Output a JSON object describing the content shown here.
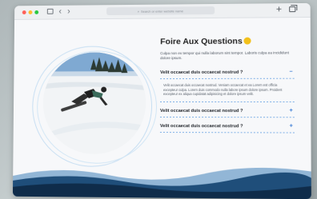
{
  "browser": {
    "colors": {
      "red": "#ff5f57",
      "yellow": "#febc2e",
      "green": "#28c840"
    },
    "address_text": "Search or enter website name",
    "icons": [
      "sidebar-icon",
      "back-icon",
      "forward-icon",
      "search-icon",
      "new-tab-icon",
      "tabs-overview-icon"
    ]
  },
  "faq": {
    "title": "Foire Aux Questions",
    "intro": "Culpa non ex tempor qui nulla laborum sint tempor. Laboris culpa ea incididunt dolore ipsum.",
    "items": [
      {
        "question": "Velit occaecat duis occaecat nostrud ?",
        "toggle": "−",
        "expanded": true,
        "answer": "Velit occaecat duis occaecat nostrud. Veniam occaecat et ea Lorem est officia excepteur culpa. Lorem duis commodo nulla labore ipsum dolore ipsum. Proident excepteur ex aliqua cupidatat adipisicing et dolore ipsum velit."
      },
      {
        "question": "Velit occaecat duis occaecat nostrud ?",
        "toggle": "+",
        "expanded": false
      },
      {
        "question": "Velit occaecat duis occaecat nostrud ?",
        "toggle": "+",
        "expanded": false
      }
    ],
    "accent": "#3a7bd5"
  },
  "hero_image": {
    "subject": "snowboarder on snowy slope",
    "ring_color": "#b9d6ee"
  },
  "footer_wave": {
    "colors": [
      "#0f2c4a",
      "#1f4e7a",
      "#3f7fb8"
    ]
  }
}
